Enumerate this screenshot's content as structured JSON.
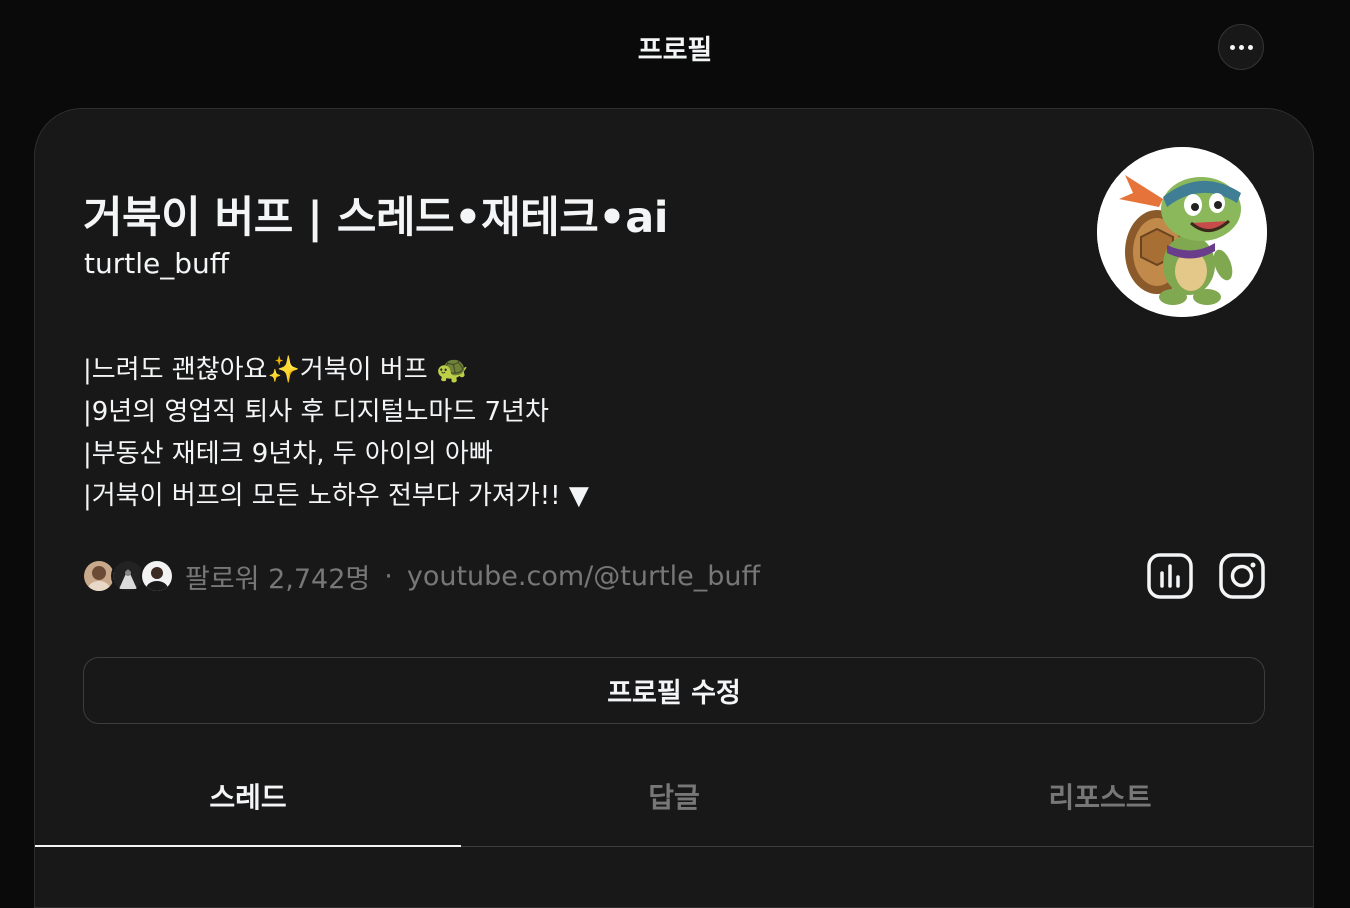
{
  "header": {
    "title": "프로필",
    "more_icon": "more-horizontal-icon"
  },
  "profile": {
    "display_name": "거북이 버프 | 스레드•재테크•ai",
    "username": "turtle_buff",
    "avatar": "turtle-avatar",
    "bio_lines": [
      "|느려도 괜찮아요✨거북이 버프 🐢",
      "|9년의 영업직 퇴사 후 디지털노마드 7년차",
      "|부동산 재테크 9년차, 두 아이의 아빠",
      "|거북이 버프의 모든 노하우 전부다 가져가!! ▼"
    ],
    "followers_text": "팔로워 2,742명",
    "separator": "·",
    "link": "youtube.com/@turtle_buff",
    "insights_icon": "insights-bar-chart-icon",
    "instagram_icon": "instagram-icon",
    "edit_button": "프로필 수정"
  },
  "tabs": [
    {
      "label": "스레드",
      "active": true
    },
    {
      "label": "답글",
      "active": false
    },
    {
      "label": "리포스트",
      "active": false
    }
  ],
  "colors": {
    "background": "#0a0a0a",
    "card": "#181818",
    "text_primary": "#f3f5f7",
    "text_secondary": "#777777",
    "border": "#3d3d3d"
  }
}
